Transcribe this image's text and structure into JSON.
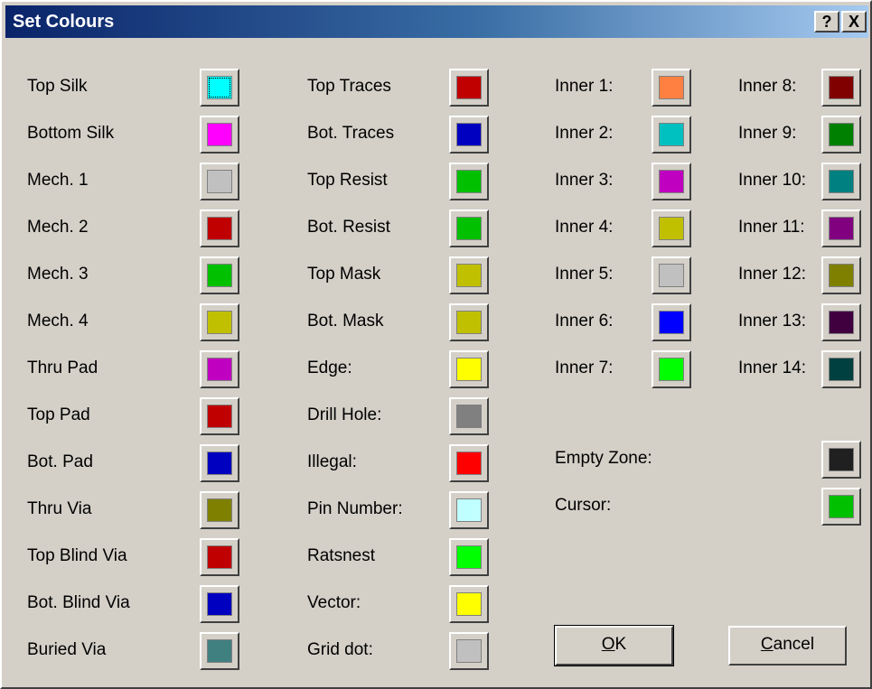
{
  "dialog": {
    "title": "Set Colours",
    "help_button": "?",
    "close_button": "X"
  },
  "columns": [
    {
      "items": [
        {
          "label": "Top Silk",
          "color": "#00ffff"
        },
        {
          "label": "Bottom Silk",
          "color": "#ff00ff"
        },
        {
          "label": "Mech. 1",
          "color": "#c0c0c0"
        },
        {
          "label": "Mech. 2",
          "color": "#c00000"
        },
        {
          "label": "Mech. 3",
          "color": "#00c000"
        },
        {
          "label": "Mech. 4",
          "color": "#c0c000"
        },
        {
          "label": "Thru Pad",
          "color": "#c000c0"
        },
        {
          "label": "Top Pad",
          "color": "#c00000"
        },
        {
          "label": "Bot. Pad",
          "color": "#0000c0"
        },
        {
          "label": "Thru Via",
          "color": "#808000"
        },
        {
          "label": "Top Blind Via",
          "color": "#c00000"
        },
        {
          "label": "Bot. Blind Via",
          "color": "#0000c0"
        },
        {
          "label": "Buried Via",
          "color": "#408080"
        }
      ]
    },
    {
      "items": [
        {
          "label": "Top Traces",
          "color": "#c00000"
        },
        {
          "label": "Bot. Traces",
          "color": "#0000c0"
        },
        {
          "label": "Top Resist",
          "color": "#00c000"
        },
        {
          "label": "Bot. Resist",
          "color": "#00c000"
        },
        {
          "label": "Top Mask",
          "color": "#c0c000"
        },
        {
          "label": "Bot. Mask",
          "color": "#c0c000"
        },
        {
          "label": "Edge:",
          "color": "#ffff00"
        },
        {
          "label": "Drill Hole:",
          "color": "#808080"
        },
        {
          "label": "Illegal:",
          "color": "#ff0000"
        },
        {
          "label": "Pin Number:",
          "color": "#c0ffff"
        },
        {
          "label": "Ratsnest",
          "color": "#00ff00"
        },
        {
          "label": "Vector:",
          "color": "#ffff00"
        },
        {
          "label": "Grid dot:",
          "color": "#c0c0c0"
        }
      ]
    },
    {
      "items": [
        {
          "label": "Inner 1:",
          "color": "#ff8040"
        },
        {
          "label": "Inner 2:",
          "color": "#00c0c0"
        },
        {
          "label": "Inner 3:",
          "color": "#c000c0"
        },
        {
          "label": "Inner 4:",
          "color": "#c0c000"
        },
        {
          "label": "Inner 5:",
          "color": "#c0c0c0"
        },
        {
          "label": "Inner 6:",
          "color": "#0000ff"
        },
        {
          "label": "Inner 7:",
          "color": "#00ff00"
        }
      ]
    },
    {
      "items": [
        {
          "label": "Inner 8:",
          "color": "#800000"
        },
        {
          "label": "Inner 9:",
          "color": "#008000"
        },
        {
          "label": "Inner 10:",
          "color": "#008080"
        },
        {
          "label": "Inner 11:",
          "color": "#800080"
        },
        {
          "label": "Inner 12:",
          "color": "#808000"
        },
        {
          "label": "Inner 13:",
          "color": "#400040"
        },
        {
          "label": "Inner 14:",
          "color": "#004040"
        }
      ]
    }
  ],
  "extras": [
    {
      "label": "Empty Zone:",
      "color": "#202020"
    },
    {
      "label": "Cursor:",
      "color": "#00c000"
    }
  ],
  "buttons": {
    "ok_label": "OK",
    "ok_mnemonic": "O",
    "cancel_label": "Cancel",
    "cancel_mnemonic": "C"
  }
}
